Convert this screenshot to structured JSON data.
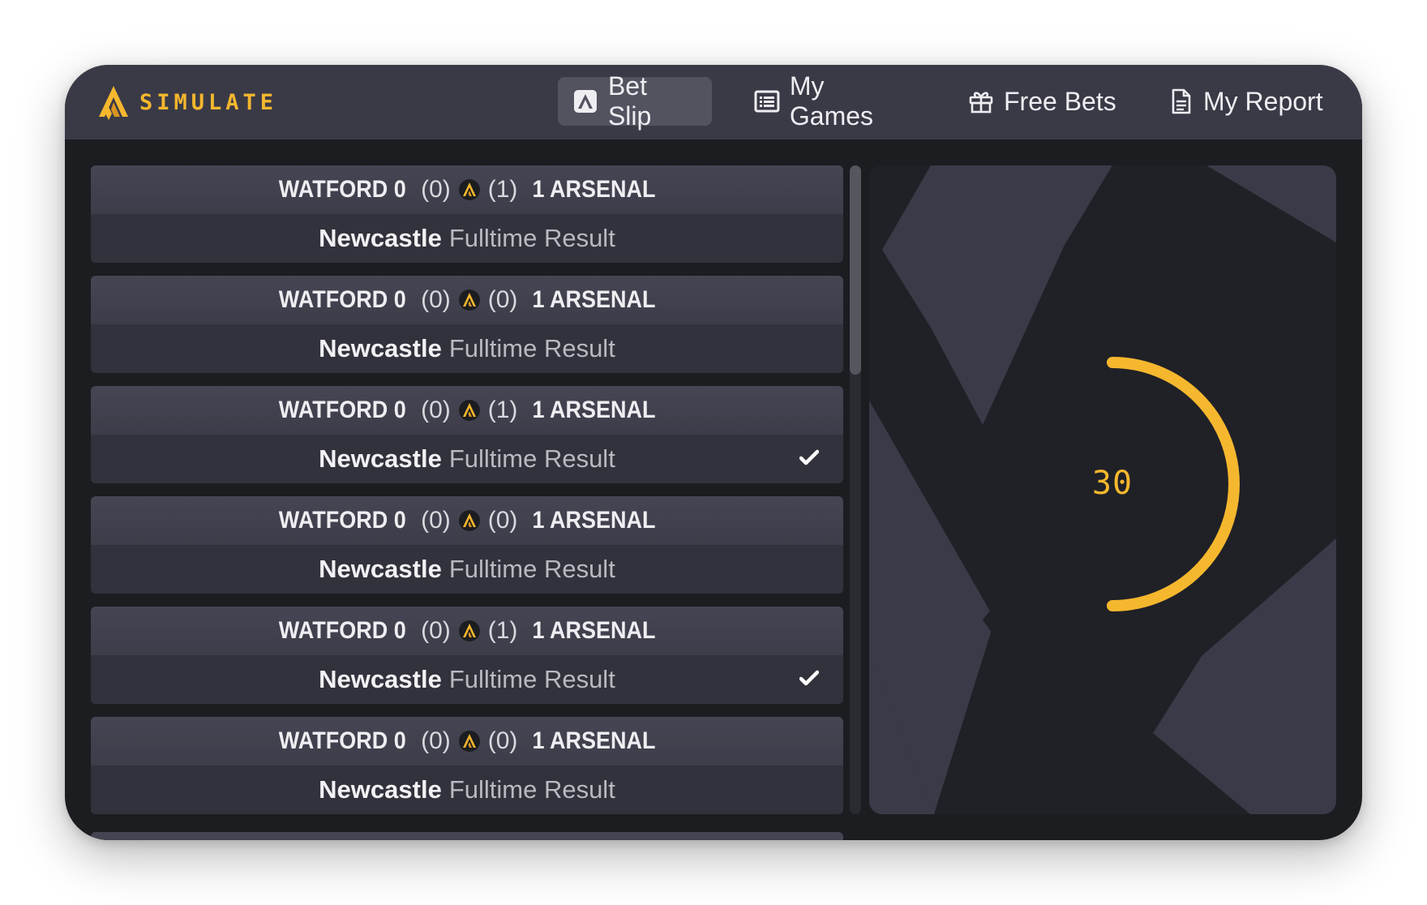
{
  "app": {
    "logo_text": "SIMULATE",
    "accent": "#f5b72e"
  },
  "nav": {
    "bet_slip": "Bet Slip",
    "my_games": "My Games",
    "free_bets": "Free Bets",
    "my_report": "My Report",
    "active": "Bet Slip"
  },
  "bets": [
    {
      "home": "WATFORD 0",
      "home_ht": "(0)",
      "away_ht": "(1)",
      "away": "1 ARSENAL",
      "club": "Newcastle",
      "market": "Fulltime Result",
      "checked": false
    },
    {
      "home": "WATFORD 0",
      "home_ht": "(0)",
      "away_ht": "(0)",
      "away": "1 ARSENAL",
      "club": "Newcastle",
      "market": "Fulltime Result",
      "checked": false
    },
    {
      "home": "WATFORD 0",
      "home_ht": "(0)",
      "away_ht": "(1)",
      "away": "1 ARSENAL",
      "club": "Newcastle",
      "market": "Fulltime Result",
      "checked": true
    },
    {
      "home": "WATFORD 0",
      "home_ht": "(0)",
      "away_ht": "(0)",
      "away": "1 ARSENAL",
      "club": "Newcastle",
      "market": "Fulltime Result",
      "checked": false
    },
    {
      "home": "WATFORD 0",
      "home_ht": "(0)",
      "away_ht": "(1)",
      "away": "1 ARSENAL",
      "club": "Newcastle",
      "market": "Fulltime Result",
      "checked": true
    },
    {
      "home": "WATFORD 0",
      "home_ht": "(0)",
      "away_ht": "(0)",
      "away": "1 ARSENAL",
      "club": "Newcastle",
      "market": "Fulltime Result",
      "checked": false
    }
  ],
  "countdown": {
    "value": "30",
    "progress": 0.5
  }
}
